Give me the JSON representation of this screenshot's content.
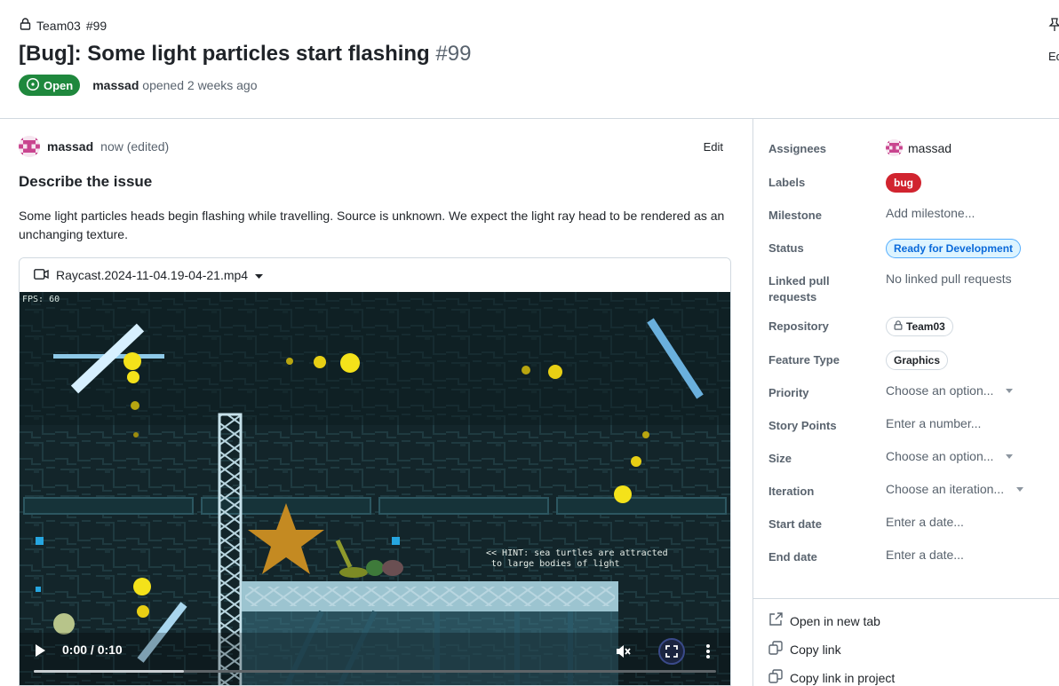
{
  "breadcrumb": {
    "repo": "Team03",
    "issue": "#99"
  },
  "issue": {
    "title": "[Bug]: Some light particles start flashing",
    "number": "#99",
    "state": "Open",
    "author": "massad",
    "opened_text": "opened 2 weeks ago"
  },
  "header_actions": {
    "edit": "Ed"
  },
  "comment": {
    "author": "massad",
    "time": "now (edited)",
    "edit": "Edit",
    "heading": "Describe the issue",
    "body": "Some light particles heads begin flashing while travelling. Source is unknown. We expect the light ray head to be rendered as an unchanging texture."
  },
  "video": {
    "filename": "Raycast.2024-11-04.19-04-21.mp4",
    "fps_overlay": "FPS: 60",
    "hint_overlay": "<< HINT: sea turtles are attracted\n to large bodies of light",
    "time": "0:00 / 0:10",
    "progress": 0.22
  },
  "sidebar": {
    "assignees": {
      "label": "Assignees",
      "value": "massad"
    },
    "labels": {
      "label": "Labels",
      "value": "bug",
      "color": "#d1242f"
    },
    "milestone": {
      "label": "Milestone",
      "value": "Add milestone..."
    },
    "status": {
      "label": "Status",
      "value": "Ready for Development"
    },
    "linked_prs": {
      "label": "Linked pull requests",
      "value": "No linked pull requests"
    },
    "repository": {
      "label": "Repository",
      "value": "Team03"
    },
    "feature_type": {
      "label": "Feature Type",
      "value": "Graphics"
    },
    "priority": {
      "label": "Priority",
      "value": "Choose an option..."
    },
    "story_points": {
      "label": "Story Points",
      "value": "Enter a number..."
    },
    "size": {
      "label": "Size",
      "value": "Choose an option..."
    },
    "iteration": {
      "label": "Iteration",
      "value": "Choose an iteration..."
    },
    "start_date": {
      "label": "Start date",
      "value": "Enter a date..."
    },
    "end_date": {
      "label": "End date",
      "value": "Enter a date..."
    }
  },
  "actions": {
    "open_new_tab": "Open in new tab",
    "copy_link": "Copy link",
    "copy_link_project": "Copy link in project"
  },
  "colors": {
    "open_green": "#1f883d",
    "bug_red": "#d1242f",
    "status_blue": "#0969da"
  }
}
